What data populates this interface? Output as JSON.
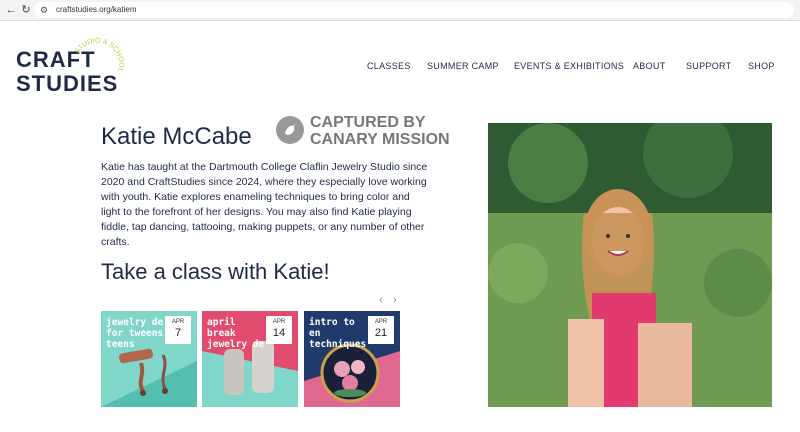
{
  "browser": {
    "back_icon": "arrow-left-icon",
    "reload_icon": "reload-icon",
    "url": "craftstudies.org/katiem"
  },
  "logo": {
    "line1": "CRAFT",
    "line2": "STUDIES",
    "arc": "STUDIO & SCHOOL"
  },
  "nav": [
    {
      "label": "CLASSES"
    },
    {
      "label": "SUMMER CAMP"
    },
    {
      "label": "EVENTS & EXHIBITIONS"
    },
    {
      "label": "ABOUT"
    },
    {
      "label": "SUPPORT"
    },
    {
      "label": "SHOP"
    }
  ],
  "profile": {
    "name": "Katie McCabe",
    "bio": "Katie has taught at the Dartmouth College Claflin Jewelry Studio since 2020 and CraftStudies since 2024, where they especially love working with youth. Katie explores enameling techniques to bring color and light to the forefront of her designs. You may also find Katie playing fiddle, tap dancing, tattooing, making puppets, or any number of other crafts."
  },
  "captured": {
    "line1": "CAPTURED BY",
    "line2": "CANARY MISSION"
  },
  "classes_heading": "Take a class with Katie!",
  "carousel": {
    "prev": "‹",
    "next": "›"
  },
  "cards": [
    {
      "title": "jewelry de for tweens teens",
      "month": "APR",
      "day": "7"
    },
    {
      "title": "april break jewelry de",
      "month": "APR",
      "day": "14"
    },
    {
      "title": "intro to en techniques",
      "month": "APR",
      "day": "21"
    }
  ]
}
